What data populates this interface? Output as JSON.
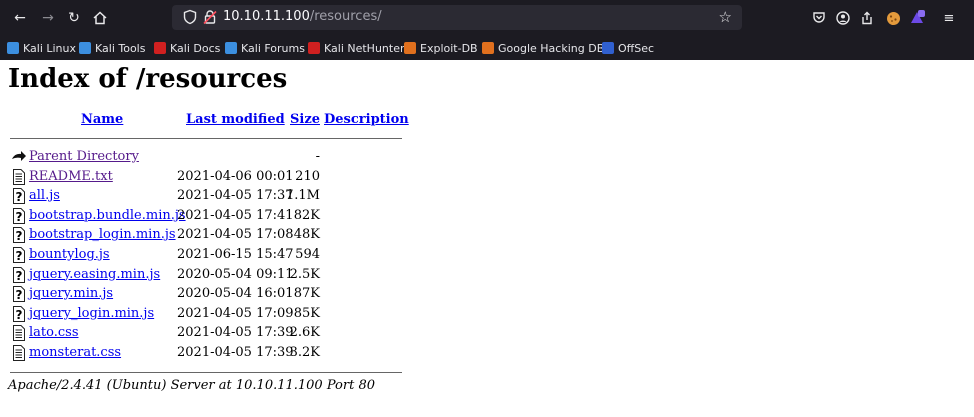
{
  "browser": {
    "url_host": "10.10.11.100",
    "url_path": "/resources/",
    "bookmarks": [
      {
        "label": "Kali Linux",
        "color": "#3c8fe0"
      },
      {
        "label": "Kali Tools",
        "color": "#3c8fe0"
      },
      {
        "label": "Kali Docs",
        "color": "#d02020"
      },
      {
        "label": "Kali Forums",
        "color": "#3c8fe0"
      },
      {
        "label": "Kali NetHunter",
        "color": "#d02020"
      },
      {
        "label": "Exploit-DB",
        "color": "#e0701e"
      },
      {
        "label": "Google Hacking DB",
        "color": "#e0701e"
      },
      {
        "label": "OffSec",
        "color": "#3060d0"
      }
    ]
  },
  "page": {
    "title": "Index of /resources",
    "columns": {
      "name": "Name",
      "modified": "Last modified",
      "size": "Size",
      "description": "Description"
    },
    "rows": [
      {
        "name": "Parent Directory",
        "modified": "",
        "size": "-",
        "icon": "back-icon",
        "visited": true
      },
      {
        "name": "README.txt",
        "modified": "2021-04-06 00:01",
        "size": "210",
        "icon": "text-file-icon",
        "visited": true
      },
      {
        "name": "all.js",
        "modified": "2021-04-05 17:37",
        "size": "1.1M",
        "icon": "unknown-file-icon",
        "visited": false
      },
      {
        "name": "bootstrap.bundle.min.js",
        "modified": "2021-04-05 17:41",
        "size": "82K",
        "icon": "unknown-file-icon",
        "visited": false
      },
      {
        "name": "bootstrap_login.min.js",
        "modified": "2021-04-05 17:08",
        "size": "48K",
        "icon": "unknown-file-icon",
        "visited": false
      },
      {
        "name": "bountylog.js",
        "modified": "2021-06-15 15:47",
        "size": "594",
        "icon": "unknown-file-icon",
        "visited": false
      },
      {
        "name": "jquery.easing.min.js",
        "modified": "2020-05-04 09:11",
        "size": "2.5K",
        "icon": "unknown-file-icon",
        "visited": false
      },
      {
        "name": "jquery.min.js",
        "modified": "2020-05-04 16:01",
        "size": "87K",
        "icon": "unknown-file-icon",
        "visited": false
      },
      {
        "name": "jquery_login.min.js",
        "modified": "2021-04-05 17:09",
        "size": "85K",
        "icon": "unknown-file-icon",
        "visited": false
      },
      {
        "name": "lato.css",
        "modified": "2021-04-05 17:39",
        "size": "2.6K",
        "icon": "text-file-icon",
        "visited": false
      },
      {
        "name": "monsterat.css",
        "modified": "2021-04-05 17:39",
        "size": "3.2K",
        "icon": "text-file-icon",
        "visited": false
      }
    ],
    "address": "Apache/2.4.41 (Ubuntu) Server at 10.10.11.100 Port 80"
  }
}
